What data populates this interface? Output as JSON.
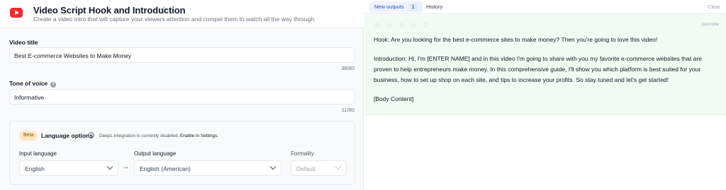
{
  "header": {
    "title": "Video Script Hook and Introduction",
    "subtitle": "Create a video intro that will capture your viewers attention and compel them to watch all the way through."
  },
  "form": {
    "video_title": {
      "label": "Video title",
      "value": "Best E-commerce Websites to Make Money",
      "counter": "38/80"
    },
    "tone": {
      "label": "Tone of voice",
      "value": "Informative",
      "counter": "11/80"
    }
  },
  "language_options": {
    "badge": "Beta",
    "title": "Language options",
    "note": "DeepL integration is currently disabled.",
    "note_link": "Enable in Settings.",
    "input_language": {
      "label": "Input language",
      "value": "English"
    },
    "output_language": {
      "label": "Output language",
      "value": "English (American)"
    },
    "formality": {
      "label": "Formality",
      "value": "Default"
    }
  },
  "outputs": {
    "tabs": {
      "new_outputs": "New outputs",
      "new_count": "1",
      "history": "History"
    },
    "clear": "Clear",
    "timestamp": "just now",
    "paragraphs": [
      "Hook: Are you looking for the best e-commerce sites to make money? Then you're going to love this video!",
      "Introduction: Hi, I'm [ENTER NAME] and in this video I'm going to share with you my favorite e-commerce websites that are proven to help entrepreneurs make money. In this comprehensive guide, I'll show you which platform is best suited for your business, how to set up shop on each site, and tips to increase your profits. So stay tuned and let's get started!",
      "[Body Content]"
    ]
  }
}
